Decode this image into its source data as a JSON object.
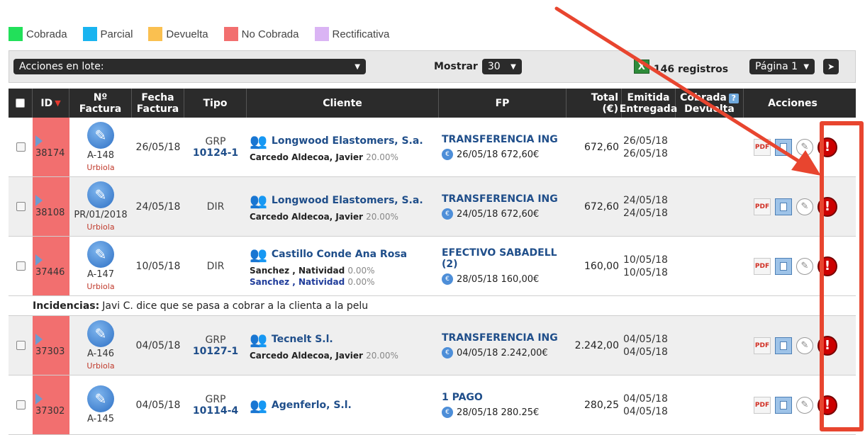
{
  "legend": [
    {
      "label": "Cobrada",
      "color": "#22e05a"
    },
    {
      "label": "Parcial",
      "color": "#19b4f0"
    },
    {
      "label": "Devuelta",
      "color": "#fac050"
    },
    {
      "label": "No Cobrada",
      "color": "#f26f6f"
    },
    {
      "label": "Rectificativa",
      "color": "#dab4f4"
    }
  ],
  "toolbar": {
    "batch_label": "Acciones en lote:",
    "show_label": "Mostrar",
    "show_value": "30",
    "records": "146 registros",
    "page_label": "Página 1",
    "next_icon": "next-arrow-icon"
  },
  "table": {
    "headers": {
      "id": "ID",
      "factura": "Nº Factura",
      "fecha": [
        "Fecha",
        "Factura"
      ],
      "tipo": "Tipo",
      "cliente": "Cliente",
      "fp": "FP",
      "total": [
        "Total",
        "(€)"
      ],
      "emitida": [
        "Emitida",
        "Entregada"
      ],
      "cobrada": [
        "Cobrada",
        "Devuelta"
      ],
      "acciones": "Acciones"
    },
    "rows": [
      {
        "id": "38174",
        "factura": "A-148",
        "usuario": "Urbiola",
        "fecha": "26/05/18",
        "tipo": "GRP",
        "tipo_link": "10124-1",
        "cliente": "Longwood Elastomers, S.a.",
        "agentes": [
          {
            "name": "Carcedo Aldecoa, Javier",
            "pct": "20.00%"
          }
        ],
        "fp": "TRANSFERENCIA ING",
        "fp_pago": "26/05/18 672,60€",
        "total": "672,60",
        "emitida": "26/05/18",
        "entregada": "26/05/18"
      },
      {
        "id": "38108",
        "factura": "PR/01/2018",
        "usuario": "Urbiola",
        "fecha": "24/05/18",
        "tipo": "DIR",
        "tipo_link": "",
        "cliente": "Longwood Elastomers, S.a.",
        "agentes": [
          {
            "name": "Carcedo Aldecoa, Javier",
            "pct": "20.00%"
          }
        ],
        "fp": "TRANSFERENCIA ING",
        "fp_pago": "24/05/18 672,60€",
        "total": "672,60",
        "emitida": "24/05/18",
        "entregada": "24/05/18"
      },
      {
        "id": "37446",
        "factura": "A-147",
        "usuario": "Urbiola",
        "fecha": "10/05/18",
        "tipo": "DIR",
        "tipo_link": "",
        "cliente": "Castillo Conde Ana Rosa",
        "agentes": [
          {
            "name": "Sanchez , Natividad",
            "pct": "0.00%"
          },
          {
            "name": "Sanchez , Natividad",
            "pct": "0.00%"
          }
        ],
        "fp": "EFECTIVO SABADELL (2)",
        "fp_pago": "28/05/18 160,00€",
        "total": "160,00",
        "emitida": "10/05/18",
        "entregada": "10/05/18"
      },
      {
        "id": "37303",
        "factura": "A-146",
        "usuario": "Urbiola",
        "fecha": "04/05/18",
        "tipo": "GRP",
        "tipo_link": "10127-1",
        "cliente": "Tecnelt S.l.",
        "agentes": [
          {
            "name": "Carcedo Aldecoa, Javier",
            "pct": "20.00%"
          }
        ],
        "fp": "TRANSFERENCIA ING",
        "fp_pago": "04/05/18 2.242,00€",
        "total": "2.242,00",
        "emitida": "04/05/18",
        "entregada": "04/05/18"
      },
      {
        "id": "37302",
        "factura": "A-145",
        "usuario": "",
        "fecha": "04/05/18",
        "tipo": "GRP",
        "tipo_link": "10114-4",
        "cliente": "Agenferlo, S.l.",
        "agentes": [],
        "fp": "1 PAGO",
        "fp_pago": "28/05/18 280.25€",
        "total": "280,25",
        "emitida": "04/05/18",
        "entregada": "04/05/18"
      }
    ],
    "incidencia": {
      "label": "Incidencias:",
      "text": "Javi C. dice que se pasa a cobrar a la clienta a la pelu"
    }
  },
  "colors": {
    "no_cobrada": "#f26f6f",
    "annotation": "#e8452f",
    "header_bg": "#2b2b2b"
  }
}
